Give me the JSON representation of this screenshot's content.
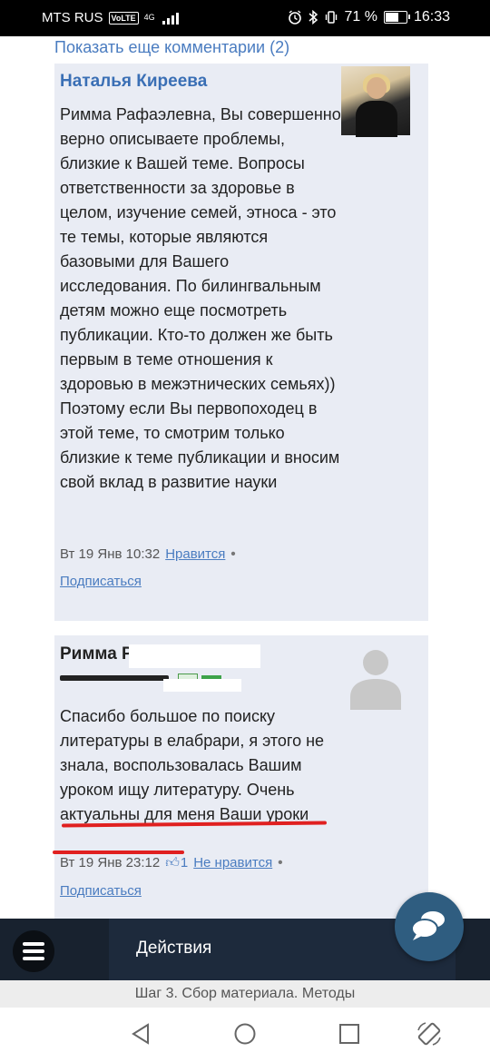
{
  "status_bar": {
    "carrier": "MTS RUS",
    "volte": "VoLTE",
    "network": "4G",
    "battery": "71 %",
    "battery_level": 0.71,
    "time": "16:33"
  },
  "comments": {
    "show_more": "Показать еще комментарии (2)",
    "items": [
      {
        "author": "Наталья Киреева",
        "text": "Римма Рафаэлевна, Вы совершенно верно описываете проблемы, близкие к Вашей теме. Вопросы ответственности за здоровье в целом, изучение семей, этноса - это те темы, которые являются базовыми для Вашего исследования. По билингвальным детям можно еще посмотреть публикации. Кто-то должен же быть первым в теме отношения к здоровью в межэтнических семьях)) Поэтому если Вы первопоходец в этой теме, то смотрим только близкие к теме публикации и вносим свой вклад в развитие науки",
        "date": "Вт 19 Янв 10:32",
        "like_label": "Нравится",
        "separator": "•",
        "subscribe": "Подписаться"
      },
      {
        "author": "Римма Ра",
        "text": "Спасибо большое по поиску литературы в елабрари, я этого не знала, воспользовалась Вашим уроком ищу литературу. Очень актуальны для меня Ваши уроки",
        "date": "Вт 19 Янв 23:12",
        "likes": "1",
        "dislike_label": "Не нравится",
        "separator": "•",
        "subscribe": "Подписаться"
      }
    ]
  },
  "toolbar": {
    "actions_label": "Действия"
  },
  "step_label": "Шаг 3. Сбор материала. Методы",
  "colors": {
    "link": "#4a7cc0",
    "card_bg": "#e9ecf4",
    "toolbar_bg": "#1d2a3c",
    "chat_button": "#2f5d80",
    "annotation_red": "#e02020"
  },
  "icons": {
    "menu": "hamburger-icon",
    "chat": "chat-bubble-icon",
    "like": "thumbs-up-icon",
    "nav_back": "triangle-back-icon",
    "nav_home": "circle-home-icon",
    "nav_recents": "square-recents-icon",
    "rotate": "rotate-icon"
  }
}
